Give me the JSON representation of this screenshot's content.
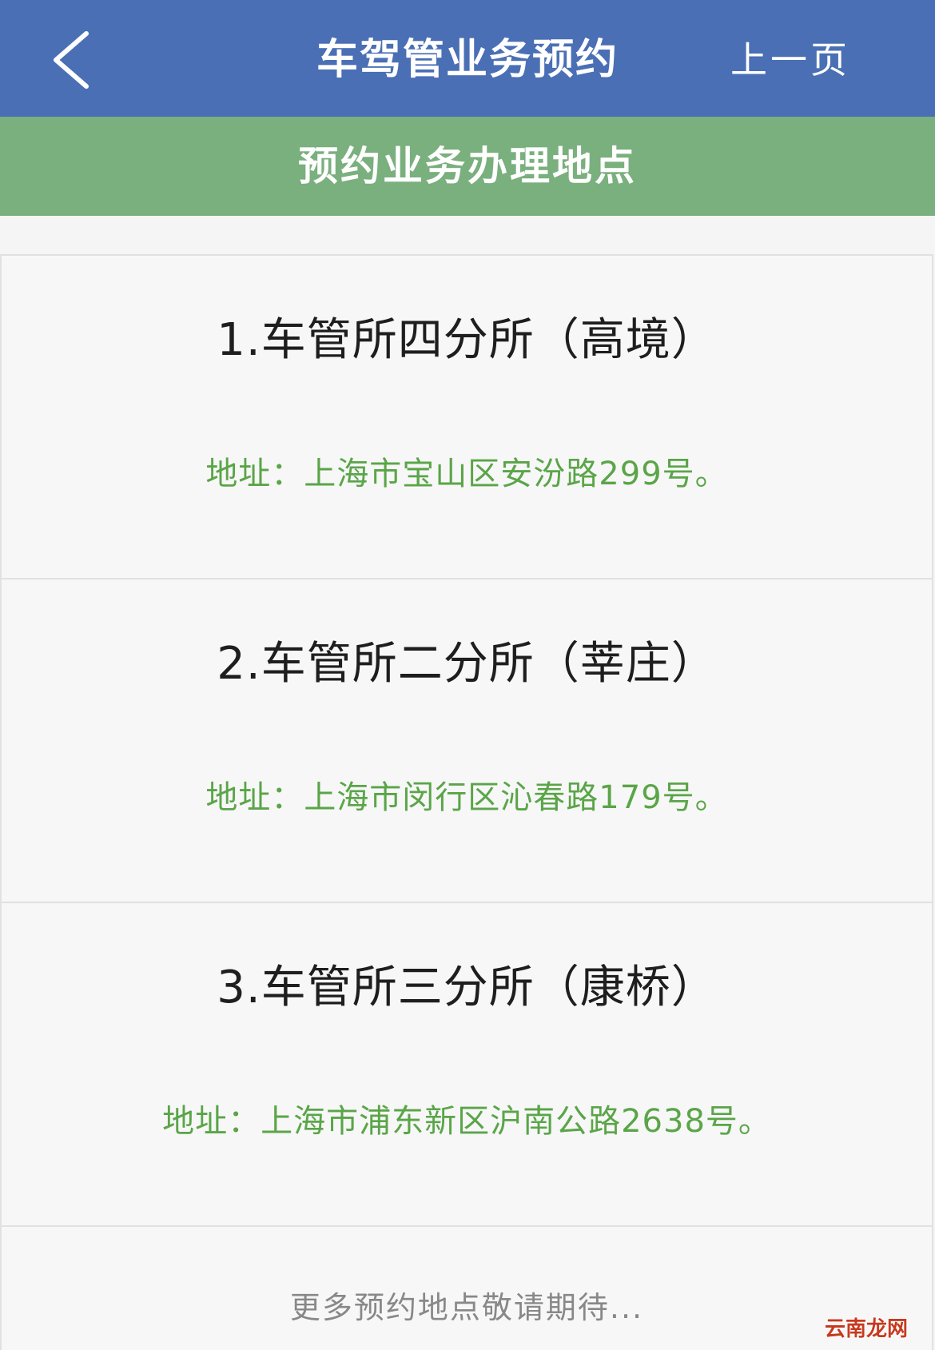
{
  "navbar": {
    "back_icon": "chevron-left-icon",
    "title": "车驾管业务预约",
    "prev_label": "上一页"
  },
  "subheader": {
    "title": "预约业务办理地点"
  },
  "locations": [
    {
      "title": "1.车管所四分所（高境）",
      "address": "地址：上海市宝山区安汾路299号。"
    },
    {
      "title": "2.车管所二分所（莘庄）",
      "address": "地址：上海市闵行区沁春路179号。"
    },
    {
      "title": "3.车管所三分所（康桥）",
      "address": "地址：上海市浦东新区沪南公路2638号。"
    }
  ],
  "footer": {
    "more_text": "更多预约地点敬请期待..."
  },
  "watermark": {
    "text": "云南龙网"
  },
  "colors": {
    "navbar_bg": "#4a6fb5",
    "subheader_bg": "#7aaf7e",
    "address_text": "#5aa548",
    "page_bg": "#f5f5f5"
  }
}
